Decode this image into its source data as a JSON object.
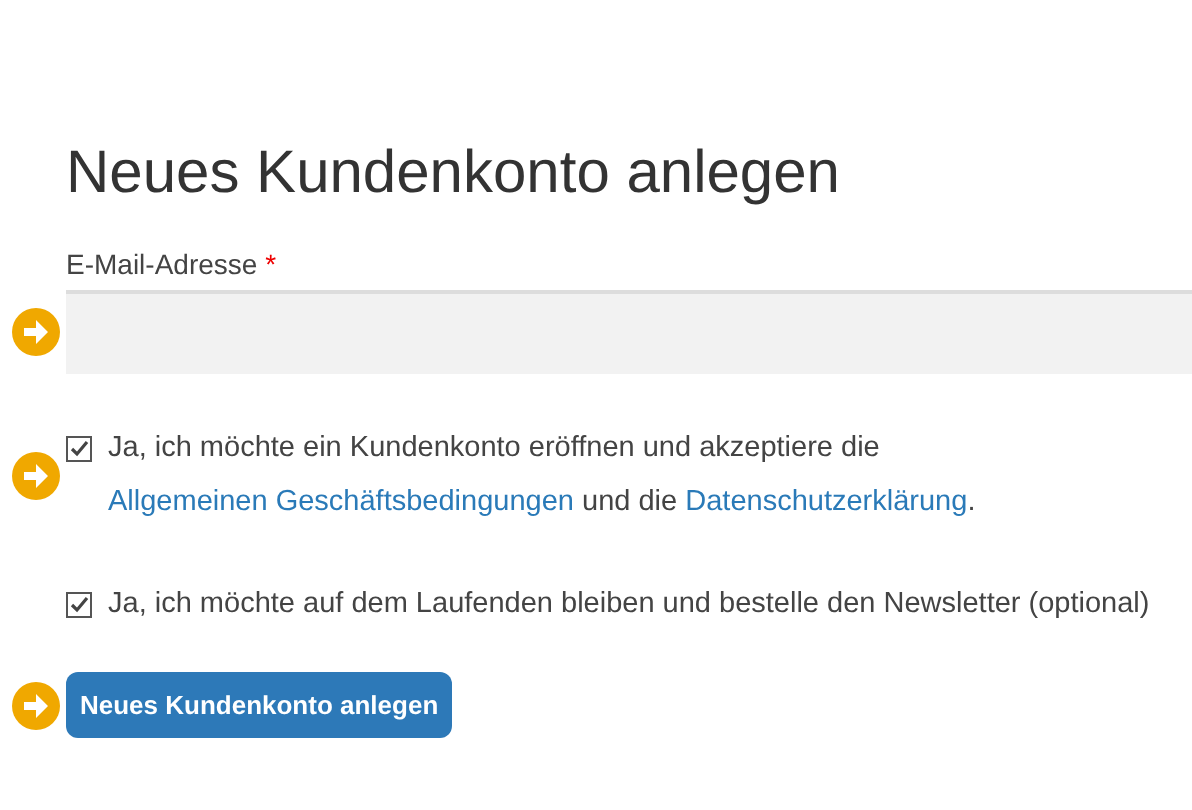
{
  "heading": "Neues Kundenkonto anlegen",
  "email": {
    "label": "E-Mail-Adresse",
    "required_mark": "*",
    "marker": true
  },
  "checkboxes": [
    {
      "checked": true,
      "marker": true,
      "parts": [
        {
          "kind": "text",
          "text": "Ja, ich möchte ein Kundenkonto eröffnen und akzeptiere die "
        },
        {
          "kind": "link",
          "text": "Allgemeinen Geschäftsbedingungen"
        },
        {
          "kind": "text",
          "text": " und die "
        },
        {
          "kind": "link",
          "text": "Datenschutzerklärung"
        },
        {
          "kind": "text",
          "text": "."
        }
      ]
    },
    {
      "checked": true,
      "marker": false,
      "parts": [
        {
          "kind": "text",
          "text": "Ja, ich möchte auf dem Laufenden bleiben und bestelle den Newsletter (optional)"
        }
      ]
    }
  ],
  "submit": {
    "label": "Neues Kundenkonto anlegen",
    "marker": true
  }
}
